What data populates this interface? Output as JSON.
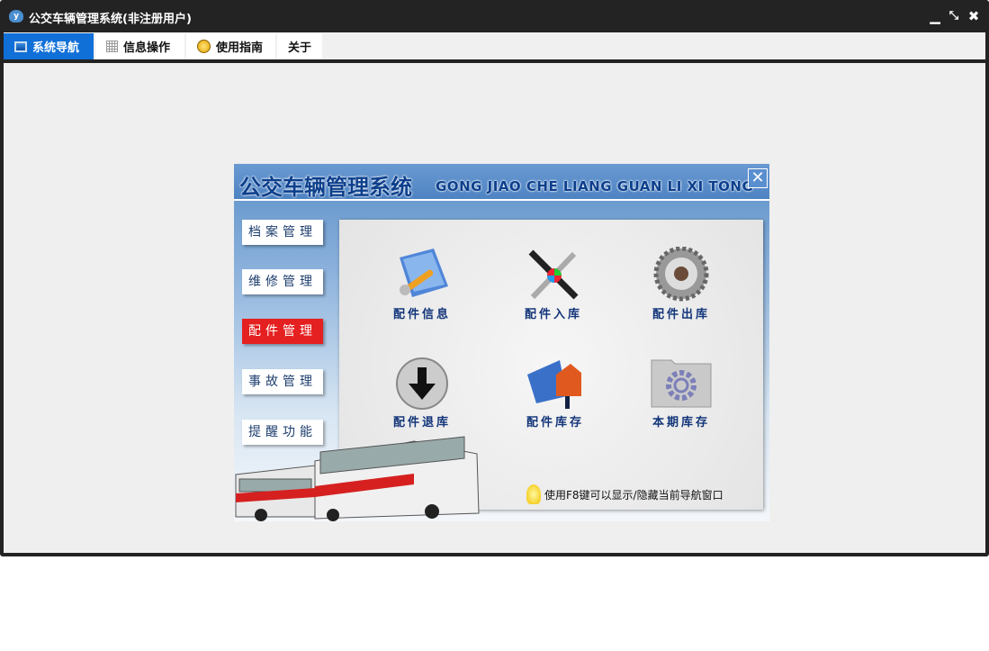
{
  "window": {
    "title": "公交车辆管理系统(非注册用户)",
    "controls": [
      "minimize",
      "restore",
      "close"
    ]
  },
  "tabs": [
    {
      "label": "系统导航",
      "icon": "monitor-icon",
      "active": true
    },
    {
      "label": "信息操作",
      "icon": "grid-icon"
    },
    {
      "label": "使用指南",
      "icon": "help-icon"
    },
    {
      "label": "关于"
    }
  ],
  "nav": {
    "title": "公交车辆管理系统",
    "subtitle": "GONG JIAO CHE LIANG GUAN LI XI TONG",
    "close": "✕",
    "side": [
      {
        "label": "档案管理"
      },
      {
        "label": "维修管理"
      },
      {
        "label": "配件管理",
        "active": true
      },
      {
        "label": "事故管理"
      },
      {
        "label": "提醒功能"
      }
    ],
    "items": [
      {
        "label": "配件信息",
        "icon": "folder-wrench-icon"
      },
      {
        "label": "配件入库",
        "icon": "tools-icon"
      },
      {
        "label": "配件出库",
        "icon": "gear-icon"
      },
      {
        "label": "配件退库",
        "icon": "download-arrow-icon"
      },
      {
        "label": "配件库存",
        "icon": "book-house-icon"
      },
      {
        "label": "本期库存",
        "icon": "folder-gear-icon"
      }
    ],
    "hint": "使用F8键可以显示/隐藏当前导航窗口",
    "colors": {
      "accent": "#1170d8",
      "active": "#e52020",
      "label": "#13357a"
    }
  }
}
